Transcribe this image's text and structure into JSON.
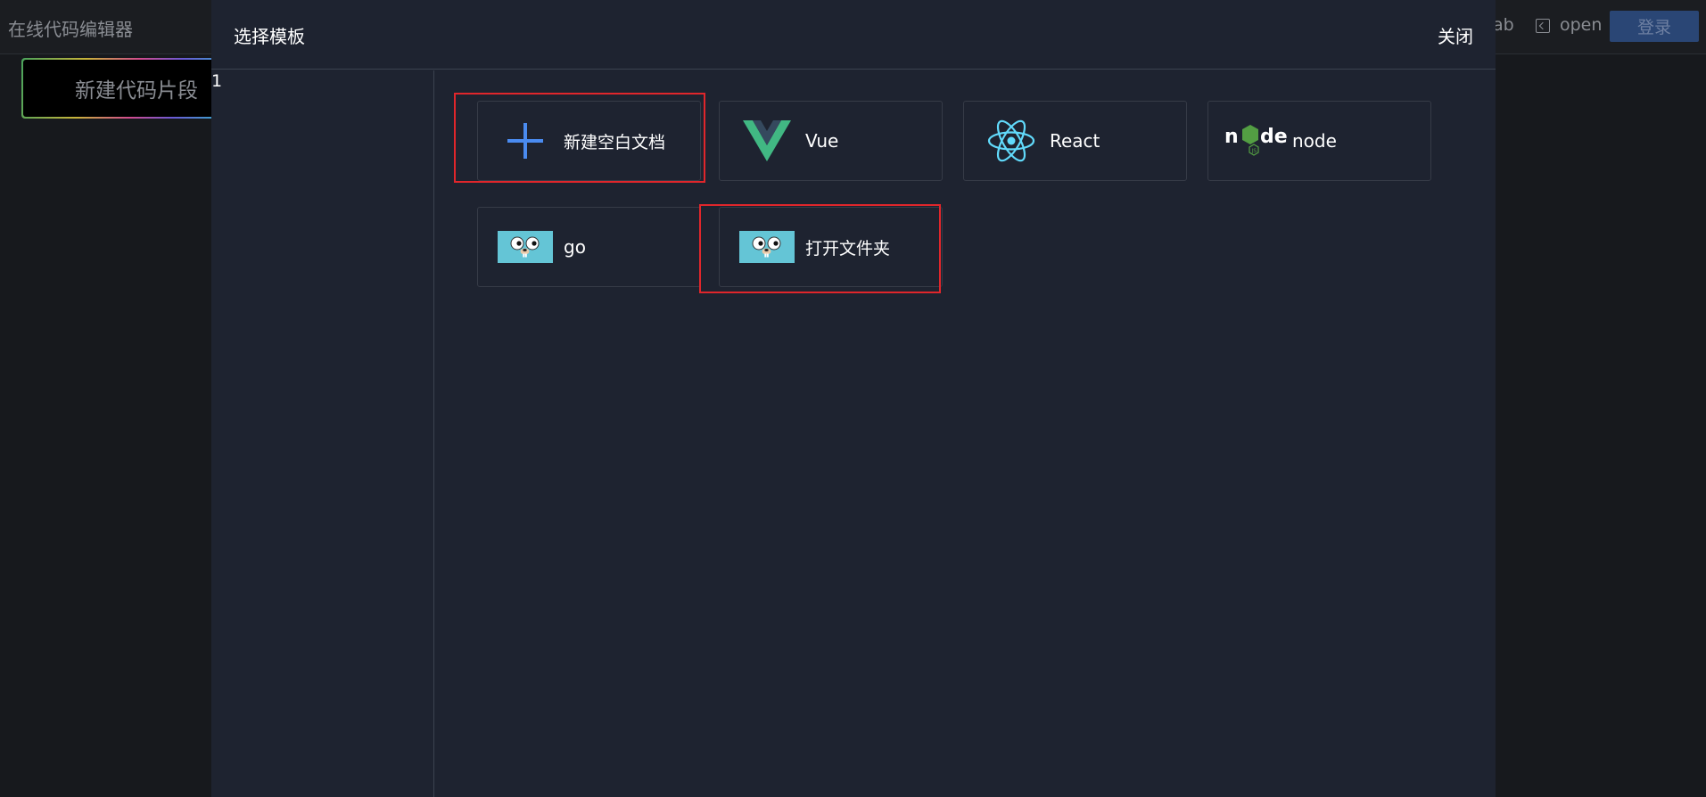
{
  "app": {
    "title": "在线代码编辑器",
    "header_tab_fragment": "ab",
    "open_label": "open",
    "login_label": "登录",
    "new_snippet_label": "新建代码片段"
  },
  "modal": {
    "title": "选择模板",
    "close_label": "关闭",
    "count": "1",
    "templates": [
      {
        "label": "新建空白文档",
        "icon": "plus-icon",
        "highlighted": true
      },
      {
        "label": "Vue",
        "icon": "vue-logo-icon",
        "highlighted": false
      },
      {
        "label": "React",
        "icon": "react-logo-icon",
        "highlighted": false
      },
      {
        "label": "node",
        "icon": "node-logo-icon",
        "highlighted": false
      },
      {
        "label": "go",
        "icon": "go-gopher-icon",
        "highlighted": false
      },
      {
        "label": "打开文件夹",
        "icon": "go-gopher-icon",
        "highlighted": true
      }
    ]
  },
  "colors": {
    "modal_bg": "#1e2330",
    "highlight": "#e0262b",
    "plus": "#4a8bf0",
    "vue_green": "#41b883",
    "vue_dark": "#35495e",
    "react_blue": "#61dafb",
    "node_green": "#539e43",
    "gopher_bg": "#64c5d6"
  }
}
